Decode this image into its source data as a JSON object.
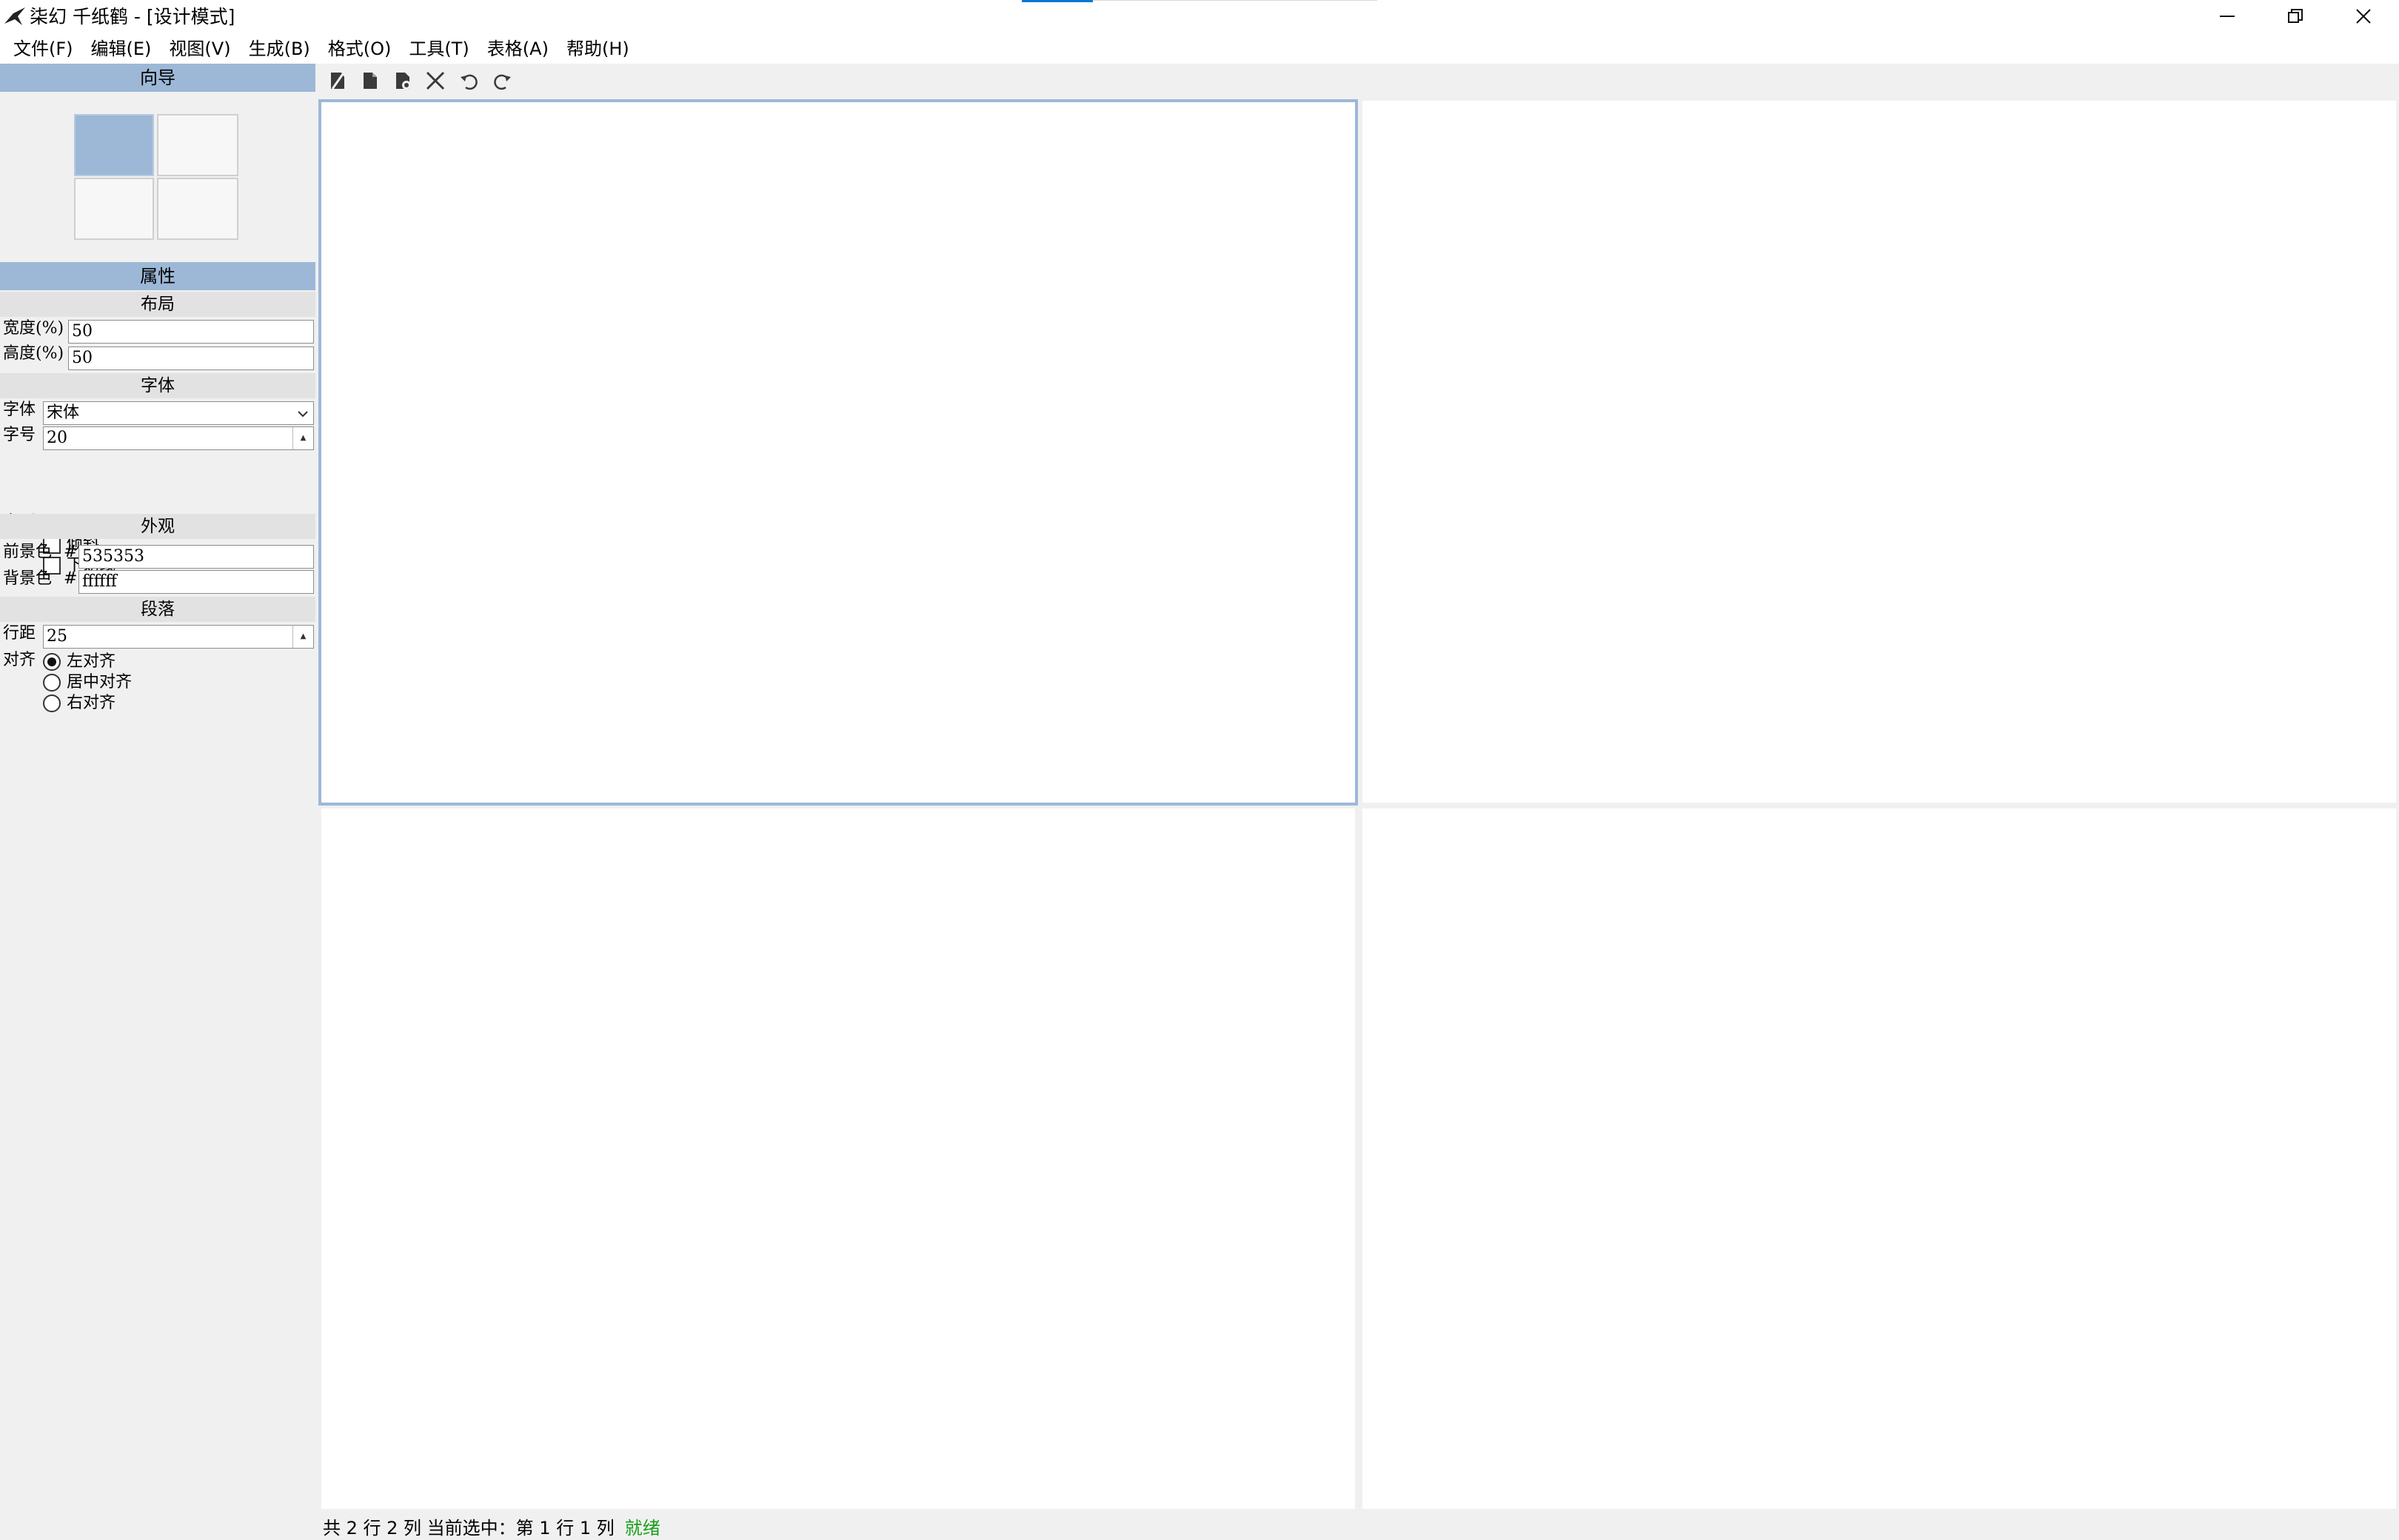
{
  "window": {
    "title": "柒幻 千纸鹤 - [设计模式]",
    "app_icon": "paper-crane-icon",
    "controls": [
      "minimize-icon",
      "restore-icon",
      "close-icon"
    ]
  },
  "menu": {
    "items": [
      "文件(F)",
      "编辑(E)",
      "视图(V)",
      "生成(B)",
      "格式(O)",
      "工具(T)",
      "表格(A)",
      "帮助(H)"
    ]
  },
  "toolbar": {
    "icons": [
      "clear-style-icon",
      "page-icon",
      "page-settings-icon",
      "delete-icon",
      "undo-icon",
      "redo-icon"
    ]
  },
  "wizard": {
    "header": "向导",
    "grid_rows": 2,
    "grid_cols": 2,
    "selected_cell": "1-1"
  },
  "properties": {
    "header": "属性",
    "layout": {
      "title": "布局",
      "width_label": "宽度(%)",
      "width_value": "50",
      "height_label": "高度(%)",
      "height_value": "50"
    },
    "font": {
      "title": "字体",
      "family_label": "字体",
      "family_value": "宋体",
      "size_label": "字号",
      "size_value": "20",
      "style_label": "字形",
      "bold_label": "加粗",
      "italic_label": "倾斜",
      "underline_label": "下划线",
      "bold": false,
      "italic": false,
      "underline": false
    },
    "appearance": {
      "title": "外观",
      "fg_label": "前景色",
      "hash": "#",
      "fg_value": "535353",
      "bg_label": "背景色",
      "bg_value": "ffffff"
    },
    "paragraph": {
      "title": "段落",
      "line_spacing_label": "行距",
      "line_spacing_value": "25",
      "align_label": "对齐",
      "align_left": "左对齐",
      "align_center": "居中对齐",
      "align_right": "右对齐",
      "align_selected": "left"
    }
  },
  "canvas": {
    "rows": 2,
    "cols": 2,
    "selected": "1-1"
  },
  "status": {
    "info": "共 2 行 2 列 当前选中：第 1 行 1 列",
    "state": "就绪"
  },
  "colors": {
    "accent": "#9db8d7",
    "status_ready": "#1aa01a"
  }
}
